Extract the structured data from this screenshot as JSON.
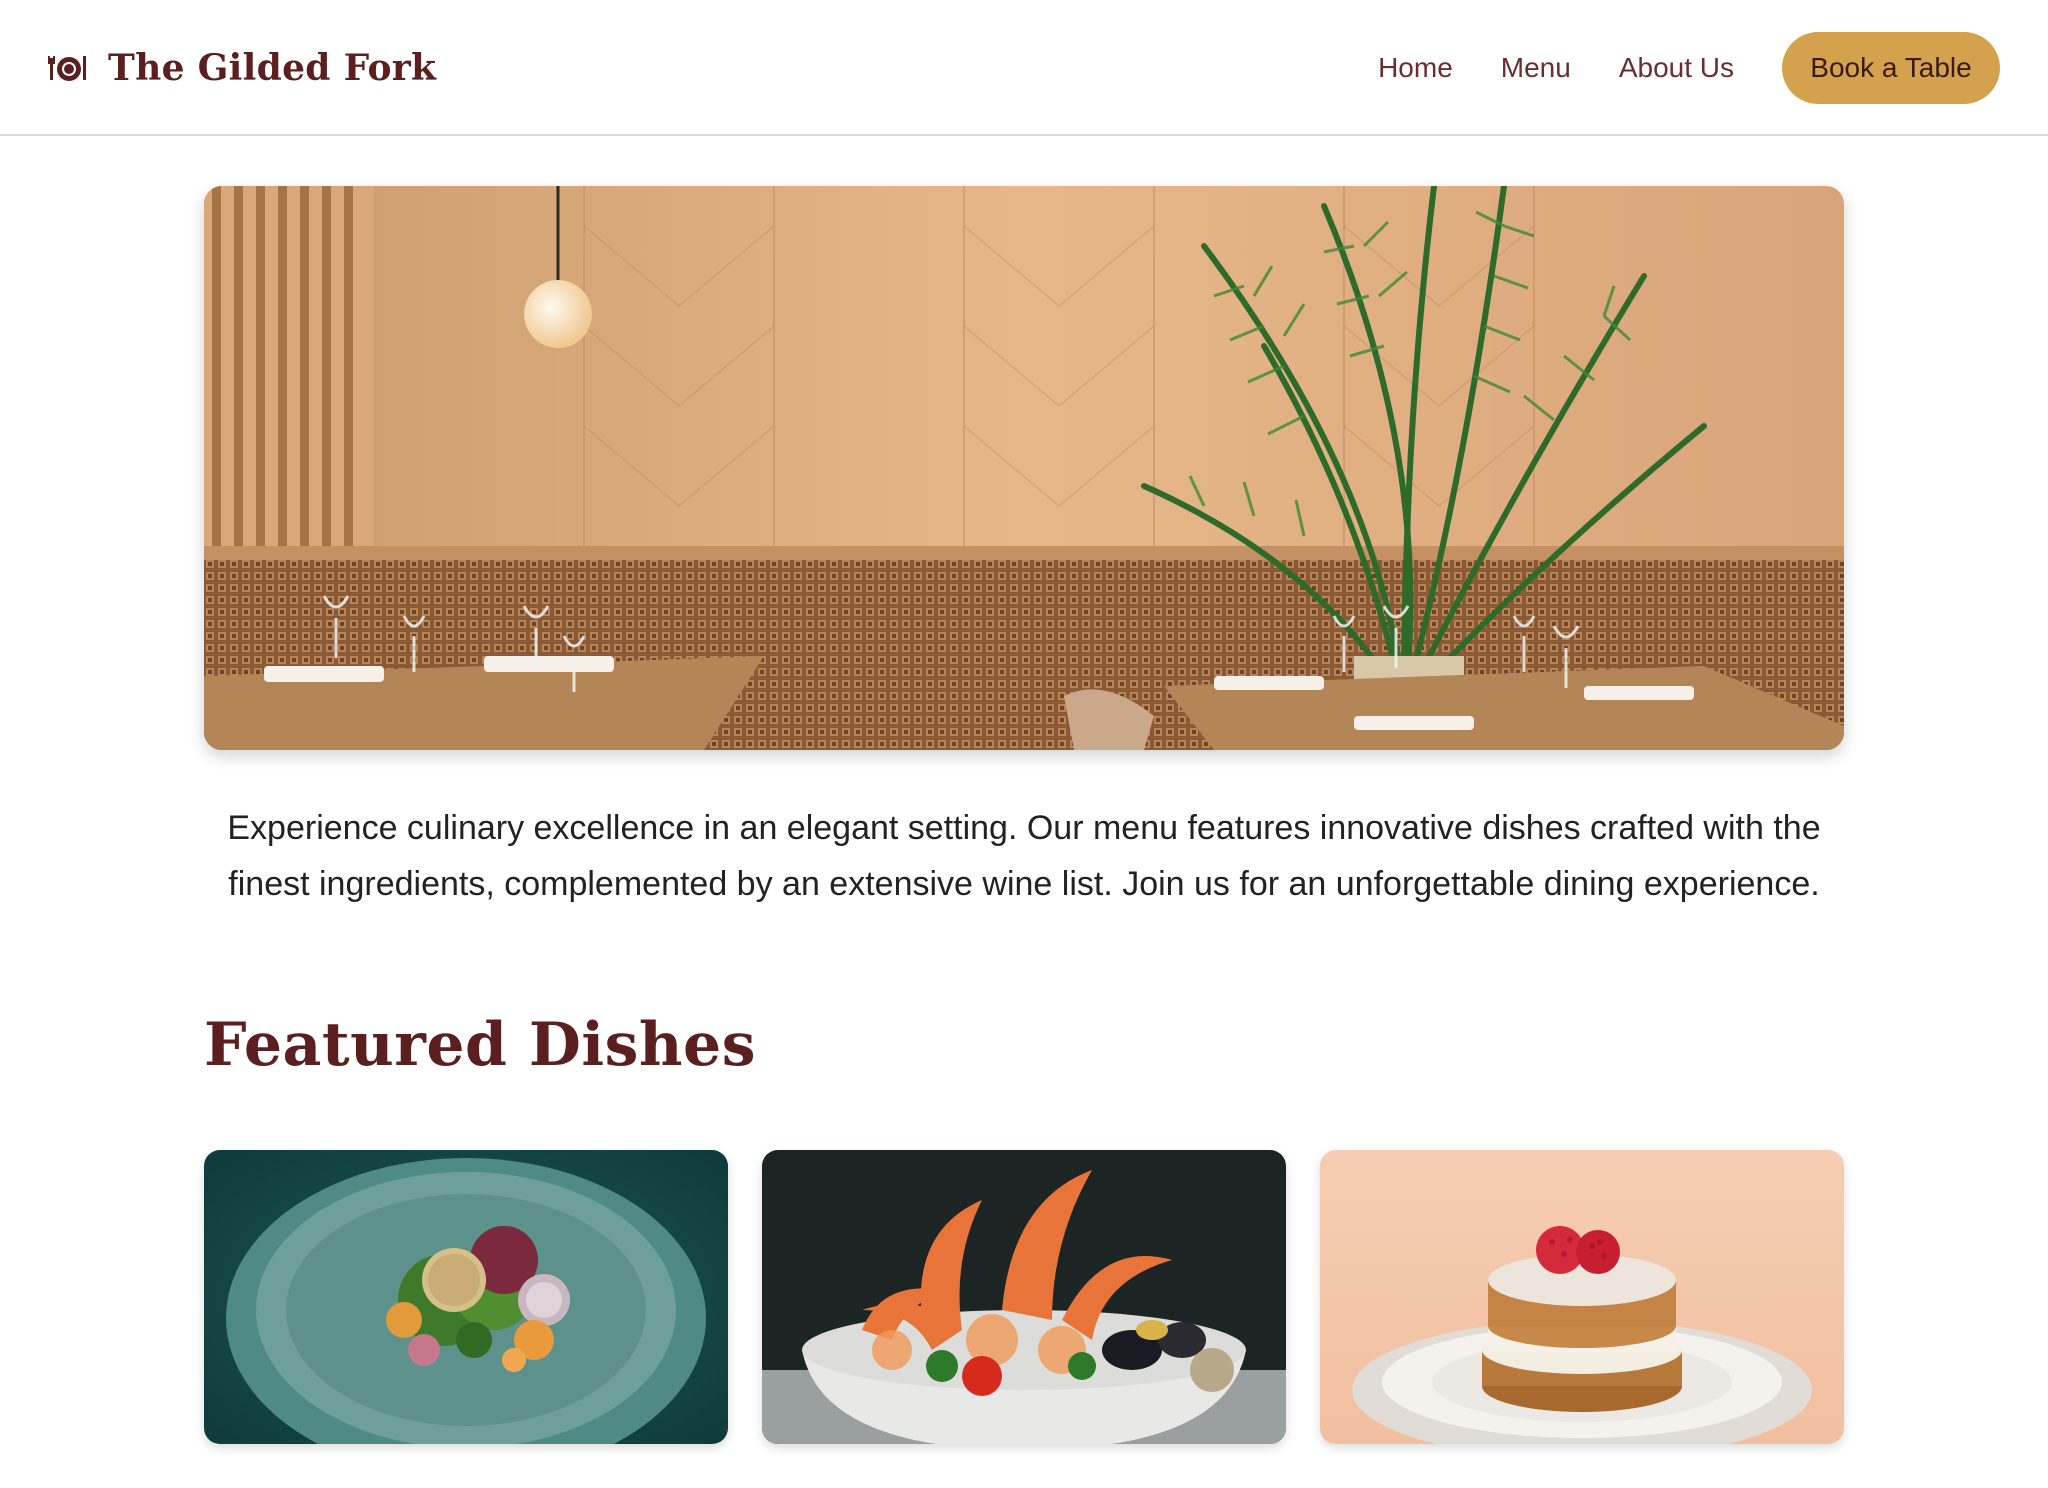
{
  "brand": {
    "name": "The Gilded Fork",
    "icon": "plate-cutlery-icon"
  },
  "nav": {
    "links": [
      "Home",
      "Menu",
      "About Us"
    ],
    "cta": "Book a Table"
  },
  "hero": {
    "image": "restaurant-interior-photo"
  },
  "intro": {
    "text": "Experience culinary excellence in an elegant setting. Our menu features innovative dishes crafted with the finest ingredients, complemented by an extensive wine list. Join us for an unforgettable dining experience."
  },
  "featured": {
    "title": "Featured Dishes",
    "dishes": [
      {
        "image": "salad-plate-photo"
      },
      {
        "image": "seafood-bowl-photo"
      },
      {
        "image": "dessert-cake-photo"
      }
    ]
  },
  "colors": {
    "brand": "#5c1f1f",
    "nav_text": "#6b2e2e",
    "cta_bg": "#d4a24c",
    "cta_text": "#3a1a12"
  }
}
